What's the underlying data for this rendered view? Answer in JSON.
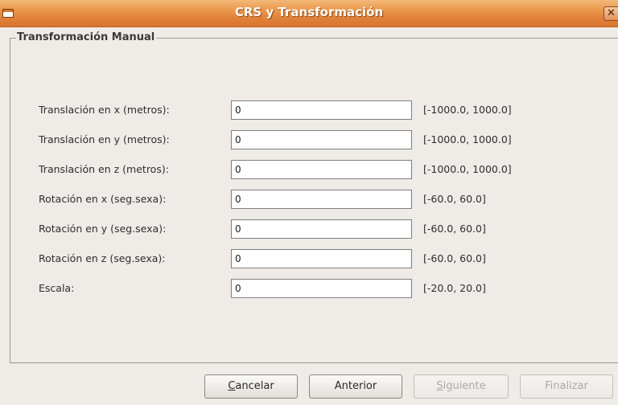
{
  "window": {
    "title": "CRS y Transformación",
    "close_glyph": "✕"
  },
  "group": {
    "legend": "Transformación Manual"
  },
  "rows": [
    {
      "label": "Translación en x (metros):",
      "value": "0",
      "range": "[-1000.0, 1000.0]"
    },
    {
      "label": "Translación en y (metros):",
      "value": "0",
      "range": "[-1000.0, 1000.0]"
    },
    {
      "label": "Translación en z (metros):",
      "value": "0",
      "range": "[-1000.0, 1000.0]"
    },
    {
      "label": "Rotación en x (seg.sexa):",
      "value": "0",
      "range": "[-60.0, 60.0]"
    },
    {
      "label": "Rotación en y (seg.sexa):",
      "value": "0",
      "range": "[-60.0, 60.0]"
    },
    {
      "label": "Rotación en z (seg.sexa):",
      "value": "0",
      "range": "[-60.0, 60.0]"
    },
    {
      "label": "Escala:",
      "value": "0",
      "range": "[-20.0, 20.0]"
    }
  ],
  "buttons": {
    "cancel": {
      "mnemonic": "C",
      "rest": "ancelar"
    },
    "previous": {
      "label": "Anterior"
    },
    "next": {
      "mnemonic": "S",
      "rest": "iguiente"
    },
    "finish": {
      "label": "Finalizar"
    }
  },
  "icons": {
    "window_menu": "window-menu-icon",
    "close": "close-icon"
  }
}
